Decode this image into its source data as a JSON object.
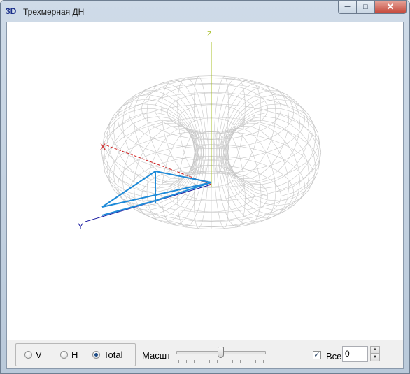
{
  "window": {
    "icon_text": "3D",
    "title": "Трехмерная ДН",
    "controls": {
      "minimize": "─",
      "maximize": "□",
      "close": "✕"
    }
  },
  "plot": {
    "axis_z_label": "Z",
    "axis_x_label": "X",
    "axis_y_label": "Y",
    "colors": {
      "mesh": "#c8c8c8",
      "z_axis": "#a8c02a",
      "x_axis": "#d02020",
      "y_axis": "#1a1aa0",
      "frame": "#1e8ad8"
    }
  },
  "controls": {
    "radios": [
      {
        "label": "V",
        "selected": false
      },
      {
        "label": "H",
        "selected": false
      },
      {
        "label": "Total",
        "selected": true
      }
    ],
    "scale_label": "Масшт",
    "scale_slider": {
      "value": 0.48
    },
    "all_checkbox": {
      "label": "Все",
      "checked": true
    },
    "spin_value": "0"
  }
}
